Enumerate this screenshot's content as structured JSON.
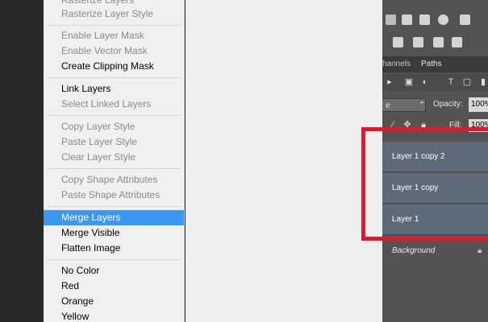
{
  "context_menu": {
    "items": [
      {
        "label": "Rasterize Layers",
        "disabled": true
      },
      {
        "label": "Rasterize Layer Style",
        "disabled": true
      },
      {
        "label": "Enable Layer Mask",
        "disabled": true
      },
      {
        "label": "Enable Vector Mask",
        "disabled": true
      },
      {
        "label": "Create Clipping Mask",
        "disabled": false
      },
      {
        "label": "Link Layers",
        "disabled": false
      },
      {
        "label": "Select Linked Layers",
        "disabled": true
      },
      {
        "label": "Copy Layer Style",
        "disabled": true
      },
      {
        "label": "Paste Layer Style",
        "disabled": true
      },
      {
        "label": "Clear Layer Style",
        "disabled": true
      },
      {
        "label": "Copy Shape Attributes",
        "disabled": true
      },
      {
        "label": "Paste Shape Attributes",
        "disabled": true
      },
      {
        "label": "Merge Layers",
        "disabled": false,
        "selected": true
      },
      {
        "label": "Merge Visible",
        "disabled": false
      },
      {
        "label": "Flatten Image",
        "disabled": false
      },
      {
        "label": "No Color",
        "disabled": false
      },
      {
        "label": "Red",
        "disabled": false
      },
      {
        "label": "Orange",
        "disabled": false
      },
      {
        "label": "Yellow",
        "disabled": false
      }
    ]
  },
  "panel": {
    "tabs": [
      {
        "label": "hannels",
        "active": false
      },
      {
        "label": "Paths",
        "active": true
      }
    ],
    "blend_mode": "e",
    "opacity_label": "Opacity:",
    "opacity_value": "100%",
    "fill_label": "Fill:",
    "fill_value": "100%"
  },
  "layers": [
    {
      "name": "Layer 1 copy 2",
      "selected": true
    },
    {
      "name": "Layer 1 copy",
      "selected": true
    },
    {
      "name": "Layer 1",
      "selected": true
    },
    {
      "name": "Background",
      "selected": false,
      "locked": true
    }
  ],
  "colors": {
    "menu_highlight": "#3c97f0",
    "layer_selected": "#5f6a79",
    "annotation_red": "#e3192b"
  }
}
